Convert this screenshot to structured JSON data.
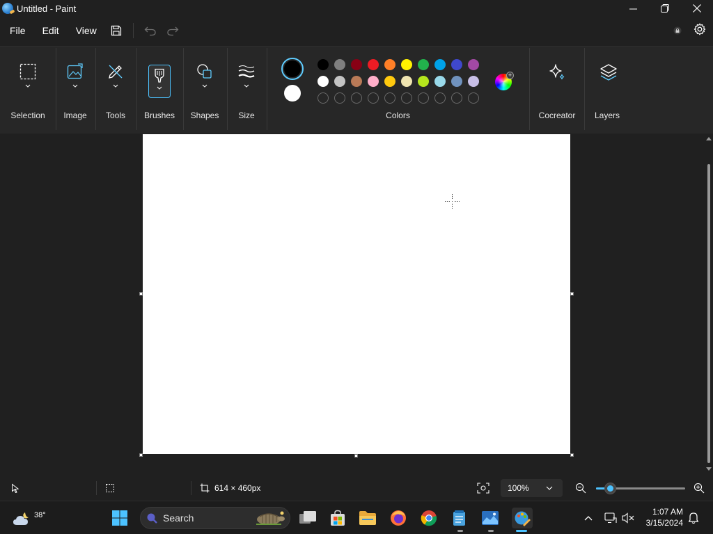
{
  "window": {
    "title": "Untitled - Paint",
    "controls": [
      "minimize",
      "maximize",
      "close"
    ]
  },
  "menu": {
    "file": "File",
    "edit": "Edit",
    "view": "View"
  },
  "ribbon": {
    "groups": {
      "selection": "Selection",
      "image": "Image",
      "tools": "Tools",
      "brushes": "Brushes",
      "shapes": "Shapes",
      "size": "Size",
      "colors": "Colors",
      "cocreator": "Cocreator",
      "layers": "Layers"
    },
    "primary_color": "#000000",
    "secondary_color": "#ffffff",
    "palette_row1": [
      "#000000",
      "#7f7f7f",
      "#880015",
      "#ed1c24",
      "#ff7f27",
      "#fff200",
      "#22b14c",
      "#00a2e8",
      "#3f48cc",
      "#a349a4"
    ],
    "palette_row2": [
      "#ffffff",
      "#c3c3c3",
      "#b97a57",
      "#ffaec9",
      "#ffc90e",
      "#efe4b0",
      "#b5e61d",
      "#99d9ea",
      "#7092be",
      "#c8bfe7"
    ],
    "palette_row3_empty_count": 10
  },
  "status": {
    "canvas_size": "614 × 460px",
    "zoom": "100%"
  },
  "taskbar": {
    "weather_temp": "38°",
    "search_label": "Search",
    "time": "1:07 AM",
    "date": "3/15/2024"
  }
}
